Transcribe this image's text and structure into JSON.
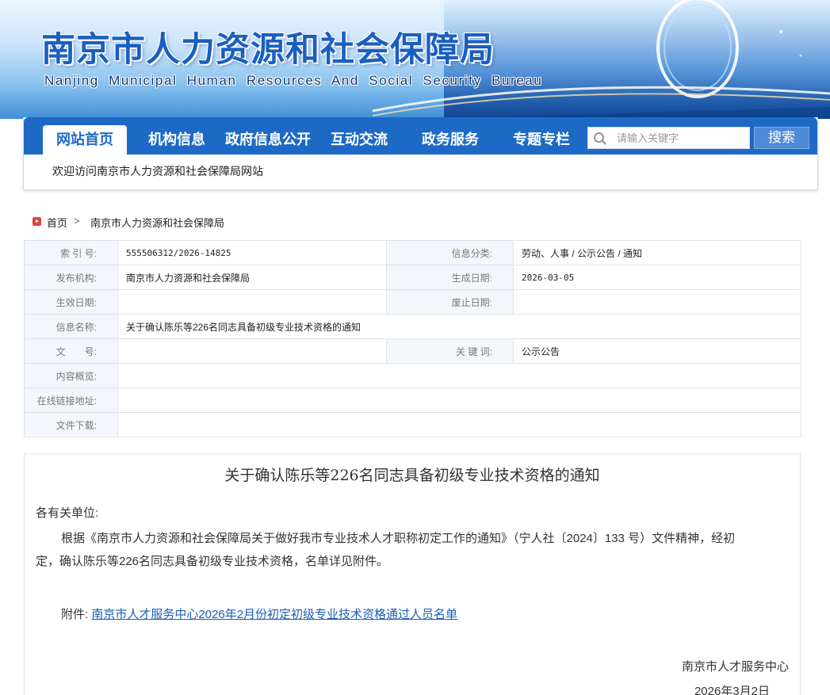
{
  "banner": {
    "title_cn": "南京市人力资源和社会保障局",
    "title_en": "Nanjing Municipal Human Resources And Social Security Bureau"
  },
  "nav": {
    "items": [
      {
        "label": "网站首页",
        "active": true
      },
      {
        "label": "机构信息",
        "active": false
      },
      {
        "label": "政府信息公开",
        "active": false
      },
      {
        "label": "互动交流",
        "active": false
      },
      {
        "label": "政务服务",
        "active": false
      },
      {
        "label": "专题专栏",
        "active": false
      }
    ],
    "search_placeholder": "请输入关键字",
    "search_button": "搜索",
    "welcome": "欢迎访问南京市人力资源和社会保障局网站"
  },
  "breadcrumb": {
    "home": "首页",
    "separator": ">",
    "current": "南京市人力资源和社会保障局"
  },
  "meta": {
    "index_label": "索 引 号:",
    "index_value": "555506312/2026-14825",
    "category_label": "信息分类:",
    "category_value": "劳动、人事 / 公示公告 / 通知",
    "publisher_label": "发布机构:",
    "publisher_value": "南京市人力资源和社会保障局",
    "created_label": "生成日期:",
    "created_value": "2026-03-05",
    "effective_label": "生效日期:",
    "effective_value": "",
    "expired_label": "废止日期:",
    "expired_value": "",
    "name_label": "信息名称:",
    "name_value": "关于确认陈乐等226名同志具备初级专业技术资格的通知",
    "doc_no_label": "文　　号:",
    "doc_no_value": "",
    "keywords_label": "关 键 词:",
    "keywords_value": "公示公告",
    "summary_label": "内容概览:",
    "summary_value": "",
    "link_label": "在线链接地址:",
    "link_value": "",
    "download_label": "文件下载:",
    "download_value": ""
  },
  "article": {
    "title": "关于确认陈乐等226名同志具备初级专业技术资格的通知",
    "salutation": "各有关单位:",
    "body_line1": "根据《南京市人力资源和社会保障局关于做好我市专业技术人才职称初定工作的通知》（宁人社〔2024〕133 号）文件精神，经初",
    "body_line2": "定，确认陈乐等226名同志具备初级专业技术资格，名单详见附件。",
    "attachment_label": "附件: ",
    "attachment_link": "南京市人才服务中心2026年2月份初定初级专业技术资格通过人员名单",
    "sign_org": "南京市人才服务中心",
    "sign_date": "2026年3月2日"
  }
}
